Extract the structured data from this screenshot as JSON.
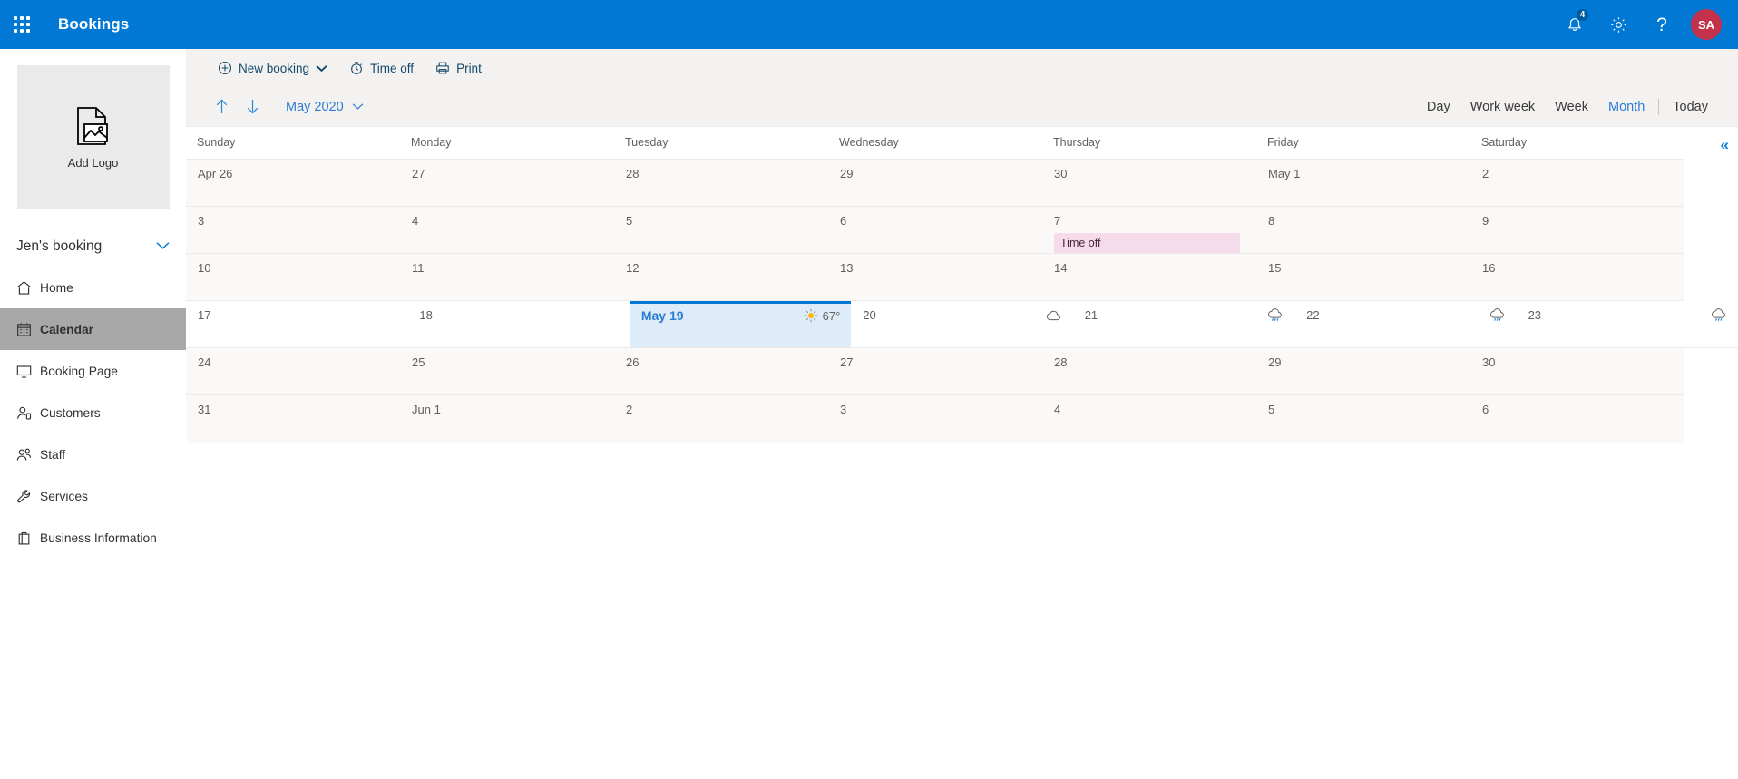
{
  "suitebar": {
    "waffle_label": "App launcher",
    "app_title": "Bookings",
    "notifications_count": "4",
    "help_glyph": "?",
    "avatar_initials": "SA",
    "brand_color": "#0078d4",
    "avatar_color": "#c4314b"
  },
  "leftnav": {
    "logo": {
      "label": "Add Logo"
    },
    "business": {
      "name": "Jen's booking"
    },
    "items": [
      {
        "label": "Home",
        "icon": "home-icon",
        "active": false
      },
      {
        "label": "Calendar",
        "icon": "calendar-icon",
        "active": true
      },
      {
        "label": "Booking Page",
        "icon": "monitor-icon",
        "active": false
      },
      {
        "label": "Customers",
        "icon": "customers-icon",
        "active": false
      },
      {
        "label": "Staff",
        "icon": "staff-icon",
        "active": false
      },
      {
        "label": "Services",
        "icon": "wrench-icon",
        "active": false
      },
      {
        "label": "Business Information",
        "icon": "briefcase-icon",
        "active": false
      }
    ]
  },
  "commandbar": {
    "new_booking": "New booking",
    "time_off": "Time off",
    "print": "Print"
  },
  "navbar": {
    "prev_label": "Previous",
    "next_label": "Next",
    "period": "May 2020",
    "views": [
      "Day",
      "Work week",
      "Week",
      "Month"
    ],
    "selected_view": "Month",
    "today": "Today"
  },
  "calendar": {
    "collapse_glyph": "«",
    "day_headers": [
      "Sunday",
      "Monday",
      "Tuesday",
      "Wednesday",
      "Thursday",
      "Friday",
      "Saturday"
    ],
    "rows": [
      {
        "white": false,
        "cells": [
          {
            "date": "Apr 26",
            "today": false,
            "weather": null,
            "temp": null,
            "event": null
          },
          {
            "date": "27",
            "today": false,
            "weather": null,
            "temp": null,
            "event": null
          },
          {
            "date": "28",
            "today": false,
            "weather": null,
            "temp": null,
            "event": null
          },
          {
            "date": "29",
            "today": false,
            "weather": null,
            "temp": null,
            "event": null
          },
          {
            "date": "30",
            "today": false,
            "weather": null,
            "temp": null,
            "event": null
          },
          {
            "date": "May 1",
            "today": false,
            "weather": null,
            "temp": null,
            "event": null
          },
          {
            "date": "2",
            "today": false,
            "weather": null,
            "temp": null,
            "event": null
          }
        ]
      },
      {
        "white": false,
        "cells": [
          {
            "date": "3",
            "today": false,
            "weather": null,
            "temp": null,
            "event": null
          },
          {
            "date": "4",
            "today": false,
            "weather": null,
            "temp": null,
            "event": null
          },
          {
            "date": "5",
            "today": false,
            "weather": null,
            "temp": null,
            "event": null
          },
          {
            "date": "6",
            "today": false,
            "weather": null,
            "temp": null,
            "event": null
          },
          {
            "date": "7",
            "today": false,
            "weather": null,
            "temp": null,
            "event": "Time off"
          },
          {
            "date": "8",
            "today": false,
            "weather": null,
            "temp": null,
            "event": null
          },
          {
            "date": "9",
            "today": false,
            "weather": null,
            "temp": null,
            "event": null
          }
        ]
      },
      {
        "white": false,
        "cells": [
          {
            "date": "10",
            "today": false,
            "weather": null,
            "temp": null,
            "event": null
          },
          {
            "date": "11",
            "today": false,
            "weather": null,
            "temp": null,
            "event": null
          },
          {
            "date": "12",
            "today": false,
            "weather": null,
            "temp": null,
            "event": null
          },
          {
            "date": "13",
            "today": false,
            "weather": null,
            "temp": null,
            "event": null
          },
          {
            "date": "14",
            "today": false,
            "weather": null,
            "temp": null,
            "event": null
          },
          {
            "date": "15",
            "today": false,
            "weather": null,
            "temp": null,
            "event": null
          },
          {
            "date": "16",
            "today": false,
            "weather": null,
            "temp": null,
            "event": null
          }
        ]
      },
      {
        "white": true,
        "cells": [
          {
            "date": "17",
            "today": false,
            "weather": null,
            "temp": null,
            "event": null
          },
          {
            "date": "18",
            "today": false,
            "weather": null,
            "temp": null,
            "event": null
          },
          {
            "date": "May 19",
            "today": true,
            "weather": "sunny",
            "temp": "67°",
            "event": null
          },
          {
            "date": "20",
            "today": false,
            "weather": "cloudy",
            "temp": null,
            "event": null
          },
          {
            "date": "21",
            "today": false,
            "weather": "rain",
            "temp": null,
            "event": null
          },
          {
            "date": "22",
            "today": false,
            "weather": "rain",
            "temp": null,
            "event": null
          },
          {
            "date": "23",
            "today": false,
            "weather": "rain",
            "temp": null,
            "event": null
          }
        ]
      },
      {
        "white": false,
        "cells": [
          {
            "date": "24",
            "today": false,
            "weather": null,
            "temp": null,
            "event": null
          },
          {
            "date": "25",
            "today": false,
            "weather": null,
            "temp": null,
            "event": null
          },
          {
            "date": "26",
            "today": false,
            "weather": null,
            "temp": null,
            "event": null
          },
          {
            "date": "27",
            "today": false,
            "weather": null,
            "temp": null,
            "event": null
          },
          {
            "date": "28",
            "today": false,
            "weather": null,
            "temp": null,
            "event": null
          },
          {
            "date": "29",
            "today": false,
            "weather": null,
            "temp": null,
            "event": null
          },
          {
            "date": "30",
            "today": false,
            "weather": null,
            "temp": null,
            "event": null
          }
        ]
      },
      {
        "white": false,
        "cells": [
          {
            "date": "31",
            "today": false,
            "weather": null,
            "temp": null,
            "event": null
          },
          {
            "date": "Jun 1",
            "today": false,
            "weather": null,
            "temp": null,
            "event": null
          },
          {
            "date": "2",
            "today": false,
            "weather": null,
            "temp": null,
            "event": null
          },
          {
            "date": "3",
            "today": false,
            "weather": null,
            "temp": null,
            "event": null
          },
          {
            "date": "4",
            "today": false,
            "weather": null,
            "temp": null,
            "event": null
          },
          {
            "date": "5",
            "today": false,
            "weather": null,
            "temp": null,
            "event": null
          },
          {
            "date": "6",
            "today": false,
            "weather": null,
            "temp": null,
            "event": null
          }
        ]
      }
    ]
  }
}
